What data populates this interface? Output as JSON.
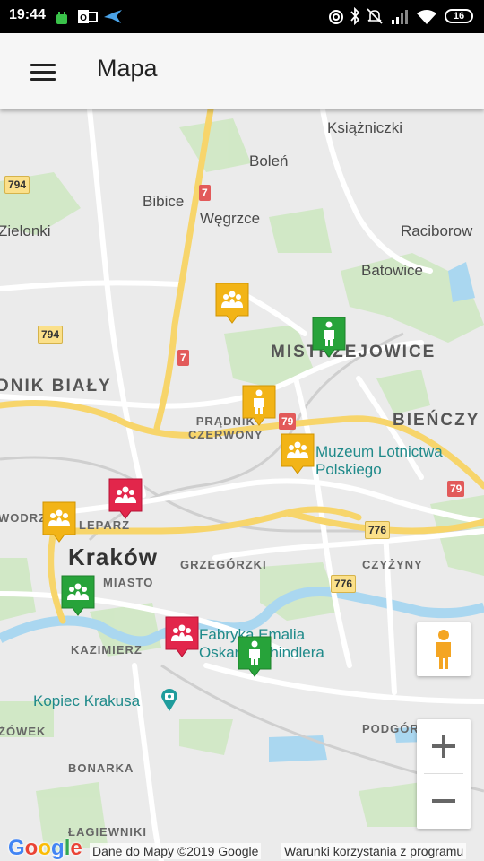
{
  "status_bar": {
    "time": "19:44",
    "battery": "16",
    "icons": [
      "android-notification-icon",
      "outlook-icon",
      "bird-app-icon",
      "hotspot-icon",
      "bluetooth-icon",
      "mute-icon",
      "signal-icon",
      "wifi-icon",
      "battery-icon"
    ]
  },
  "app_bar": {
    "title": "Mapa",
    "menu_icon": "hamburger-menu-icon"
  },
  "map": {
    "places": {
      "ksiazniczki": "Książniczki",
      "bolen": "Boleń",
      "bibice": "Bibice",
      "wegrzce": "Węgrzce",
      "zielonki": "Zielonki",
      "raciborow": "Raciborow",
      "batowice": "Batowice"
    },
    "districts": {
      "mistrzejowice": "MISTRZEJOWICE",
      "pradnik_bialy": "DNIK BIAŁY",
      "bienczyce": "BIEŃCZY",
      "pradnik_czerwony": "PRĄDNIK\nCZERWONY",
      "wodrza": "WODRZA",
      "kleparz": "LEPARZ",
      "grzegorzki": "GRZEGÓRZKI",
      "czyzyny": "CZYŻYNY",
      "stare_miasto": "MIASTO",
      "kazimierz": "KAZIMIERZ",
      "zowek": "ŻÓWEK",
      "podgorze": "PODGÓRZ",
      "bonarka": "BONARKA",
      "lagiewniki": "ŁAGIEWNIKI"
    },
    "city": "Kraków",
    "pois": {
      "museum": "Muzeum Lotnictwa\nPolskiego",
      "fabryka": "Fabryka Emalia\nOskara Schindlera",
      "kopiec": "Kopiec Krakusa"
    },
    "roads": {
      "r794a": "794",
      "r794b": "794",
      "r7a": "7",
      "r7b": "7",
      "r79a": "79",
      "r79b": "79",
      "r776a": "776",
      "r776b": "776"
    },
    "markers": [
      {
        "type": "group",
        "color": "#f2b417"
      },
      {
        "type": "single",
        "color": "#27a33a"
      },
      {
        "type": "single",
        "color": "#f2b417"
      },
      {
        "type": "group",
        "color": "#f2b417"
      },
      {
        "type": "group",
        "color": "#e2264b"
      },
      {
        "type": "group",
        "color": "#f2b417"
      },
      {
        "type": "group",
        "color": "#27a33a"
      },
      {
        "type": "group",
        "color": "#e2264b"
      },
      {
        "type": "single",
        "color": "#27a33a"
      }
    ],
    "controls": {
      "zoom_in": "+",
      "zoom_out": "−",
      "street_view_icon": "pegman-icon"
    },
    "attribution": {
      "logo": "Google",
      "data": "Dane do Mapy ©2019 Google",
      "terms": "Warunki korzystania z programu"
    }
  },
  "colors": {
    "yellow_marker": "#f2b417",
    "green_marker": "#27a33a",
    "red_marker": "#e2264b",
    "poi_text": "#1f8a8a"
  }
}
